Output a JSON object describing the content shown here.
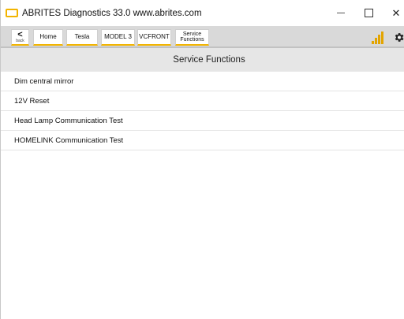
{
  "window": {
    "title": "ABRITES Diagnostics 33.0   www.abrites.com",
    "minimize": "—",
    "close": "✕"
  },
  "toolbar": {
    "back_arrow": "<",
    "back_label": "back",
    "breadcrumbs": [
      "Home",
      "Tesla",
      "MODEL 3",
      "VCFRONT",
      "Service\nFunctions"
    ],
    "signal_level": 4,
    "signal_color": "#e3a400",
    "settings_icon": "gear-icon"
  },
  "main": {
    "header": "Service Functions",
    "items": [
      "Dim central mirror",
      "12V Reset",
      "Head Lamp Communication Test",
      "HOMELINK  Communication Test"
    ]
  },
  "colors": {
    "accent": "#f2b400",
    "toolbar_bg": "#d9d9d9",
    "header_bg": "#e6e6e6"
  }
}
